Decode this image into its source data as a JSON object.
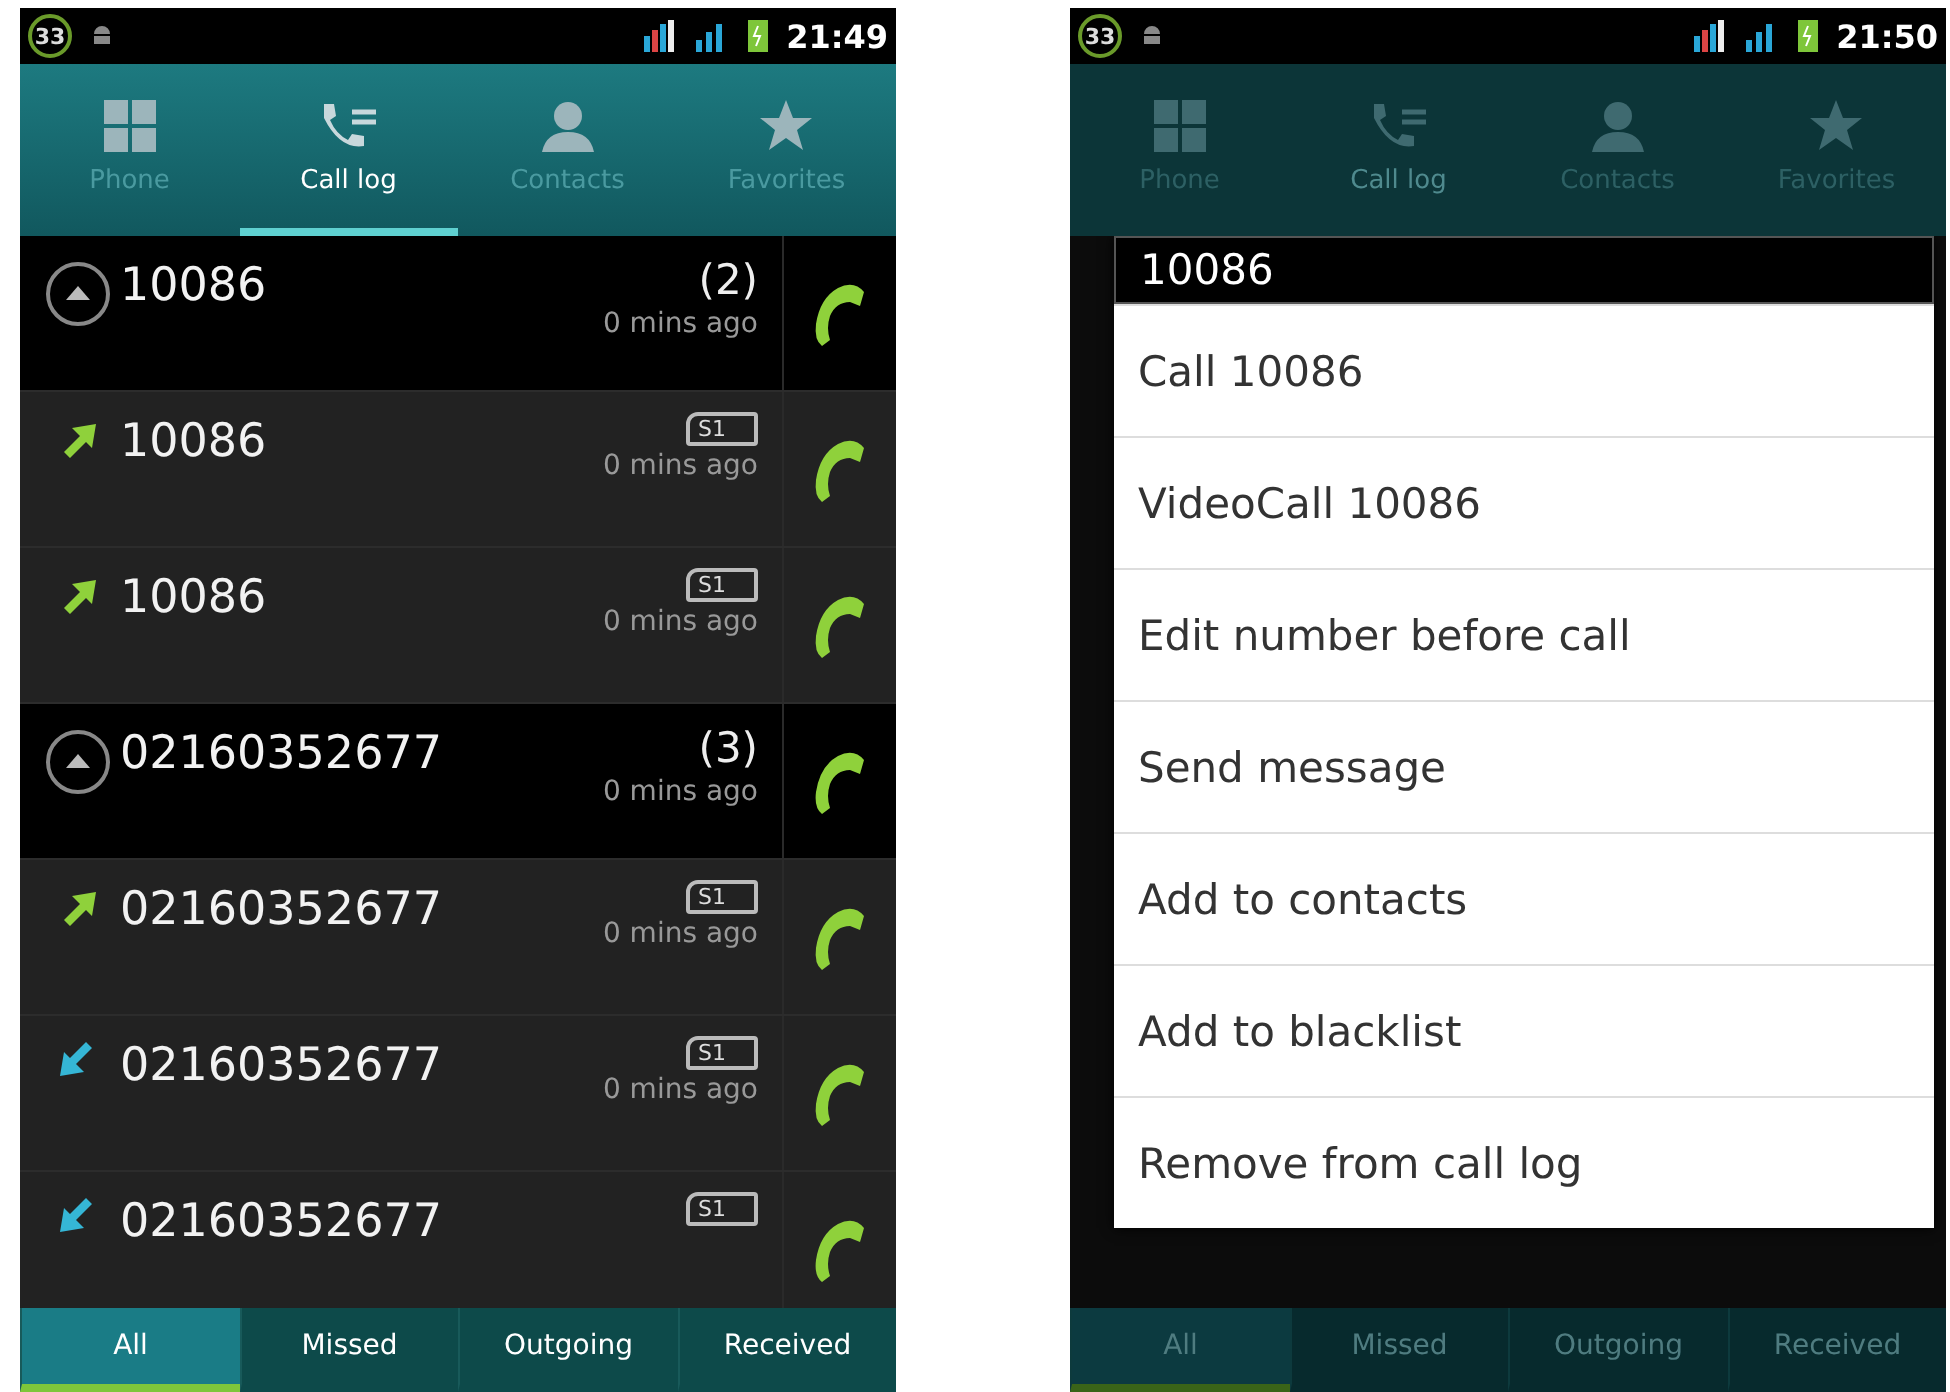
{
  "screens": [
    {
      "status_bar": {
        "badge": "33",
        "time": "21:49"
      },
      "dimmed": false,
      "tabs": [
        {
          "label": "Phone",
          "kind": "dialpad",
          "selected": false
        },
        {
          "label": "Call log",
          "kind": "calllog",
          "selected": true
        },
        {
          "label": "Contacts",
          "kind": "person",
          "selected": false
        },
        {
          "label": "Favorites",
          "kind": "star",
          "selected": false
        }
      ],
      "call_log": [
        {
          "kind": "group",
          "number": "10086",
          "count": "(2)",
          "time": "0 mins ago"
        },
        {
          "kind": "outgoing",
          "number": "10086",
          "sim": "S1",
          "time": "0 mins ago"
        },
        {
          "kind": "outgoing",
          "number": "10086",
          "sim": "S1",
          "time": "0 mins ago"
        },
        {
          "kind": "group",
          "number": "02160352677",
          "count": "(3)",
          "time": "0 mins ago"
        },
        {
          "kind": "outgoing",
          "number": "02160352677",
          "sim": "S1",
          "time": "0 mins ago"
        },
        {
          "kind": "incoming",
          "number": "02160352677",
          "sim": "S1",
          "time": "0 mins ago"
        },
        {
          "kind": "incoming",
          "number": "02160352677",
          "sim": "S1"
        }
      ],
      "filters": [
        {
          "label": "All",
          "selected": true
        },
        {
          "label": "Missed",
          "selected": false
        },
        {
          "label": "Outgoing",
          "selected": false
        },
        {
          "label": "Received",
          "selected": false
        }
      ]
    },
    {
      "status_bar": {
        "badge": "33",
        "time": "21:50"
      },
      "dimmed": true,
      "tabs": [
        {
          "label": "Phone",
          "kind": "dialpad",
          "selected": false
        },
        {
          "label": "Call log",
          "kind": "calllog",
          "selected": true
        },
        {
          "label": "Contacts",
          "kind": "person",
          "selected": false
        },
        {
          "label": "Favorites",
          "kind": "star",
          "selected": false
        }
      ],
      "context_menu": {
        "title": "10086",
        "items": [
          "Call 10086",
          "VideoCall 10086",
          "Edit number before call",
          "Send message",
          "Add to contacts",
          "Add to blacklist",
          "Remove from call log"
        ]
      },
      "filters": [
        {
          "label": "All",
          "selected": true
        },
        {
          "label": "Missed",
          "selected": false
        },
        {
          "label": "Outgoing",
          "selected": false
        },
        {
          "label": "Received",
          "selected": false
        }
      ]
    }
  ]
}
